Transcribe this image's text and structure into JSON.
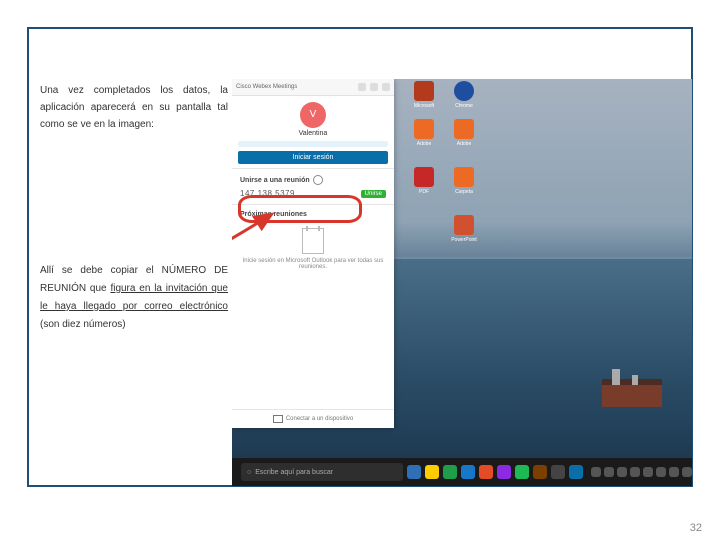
{
  "page_number": "32",
  "left": {
    "p1": "Una vez completados los datos, la aplicación aparecerá en su pantalla tal como se ve en la imagen:",
    "p2a": "Allí se debe copiar el NÚMERO DE REUNIÓN que ",
    "p2u": "figura en la invitación que le haya llegado por correo electrónico",
    "p2b": " (son diez números)"
  },
  "panel": {
    "window_title": "Cisco Webex Meetings",
    "avatar_initial": "V",
    "user_name": "Valentina",
    "user_email_placeholder": "",
    "login_btn": "Iniciar sesión",
    "join_header": "Unirse a una reunión",
    "meeting_number": "147 138 5379",
    "join_chip": "Unirse",
    "upcoming_header": "Próximas reuniones",
    "outlook_msg": "Inicie sesión en Microsoft Outlook para ver todas sus reuniones.",
    "footer": "Conectar a un dispositivo"
  },
  "taskbar": {
    "search_placeholder": "Escribe aquí para buscar"
  },
  "desktop_icons": {
    "d1": "Microsoft",
    "d2": "Chrome",
    "d3": "Adobe",
    "d4": "Adobe",
    "d5": "PDF",
    "d6": "Carpeta",
    "d7": "PowerPoint"
  },
  "tb_colors": [
    "#2e6fb5",
    "#ffcc00",
    "#1e9e4a",
    "#1778c9",
    "#e34c26",
    "#8a2be2",
    "#1db954",
    "#7b3f00",
    "#444",
    "#0a6ea8"
  ],
  "tray_count": 12
}
